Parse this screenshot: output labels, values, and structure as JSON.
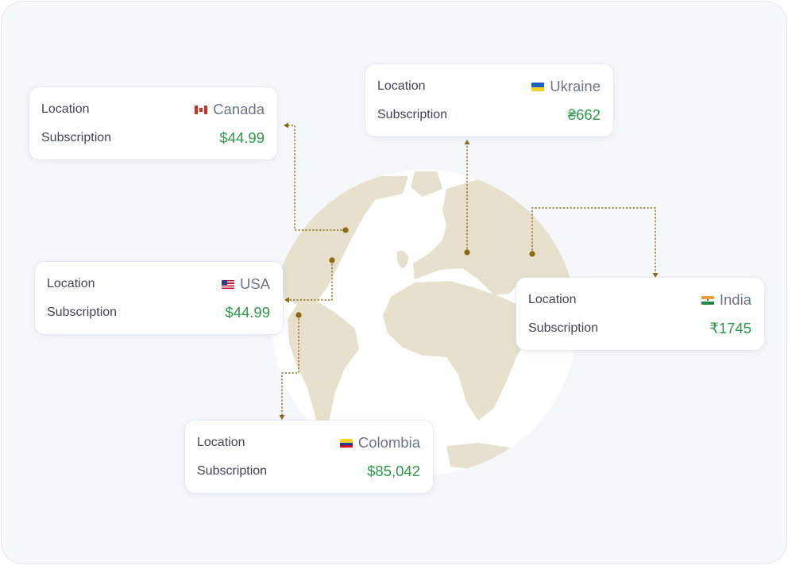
{
  "colors": {
    "background": "#f5f8fb",
    "card": "#ffffff",
    "continent": "#e6e0cd",
    "ocean": "#ffffff",
    "connector": "#8a6a12",
    "price": "#2e9a49",
    "country_text": "#6b7585",
    "label_text": "#3f4650"
  },
  "labels": {
    "location": "Location",
    "subscription": "Subscription"
  },
  "cards": [
    {
      "id": "canada",
      "country": "Canada",
      "flag": "canada-flag-icon",
      "price": "$44.99"
    },
    {
      "id": "ukraine",
      "country": "Ukraine",
      "flag": "ukraine-flag-icon",
      "price": "₴662"
    },
    {
      "id": "usa",
      "country": "USA",
      "flag": "usa-flag-icon",
      "price": "$44.99"
    },
    {
      "id": "india",
      "country": "India",
      "flag": "india-flag-icon",
      "price": "₹1745"
    },
    {
      "id": "colombia",
      "country": "Colombia",
      "flag": "colombia-flag-icon",
      "price": "$85,042"
    }
  ]
}
